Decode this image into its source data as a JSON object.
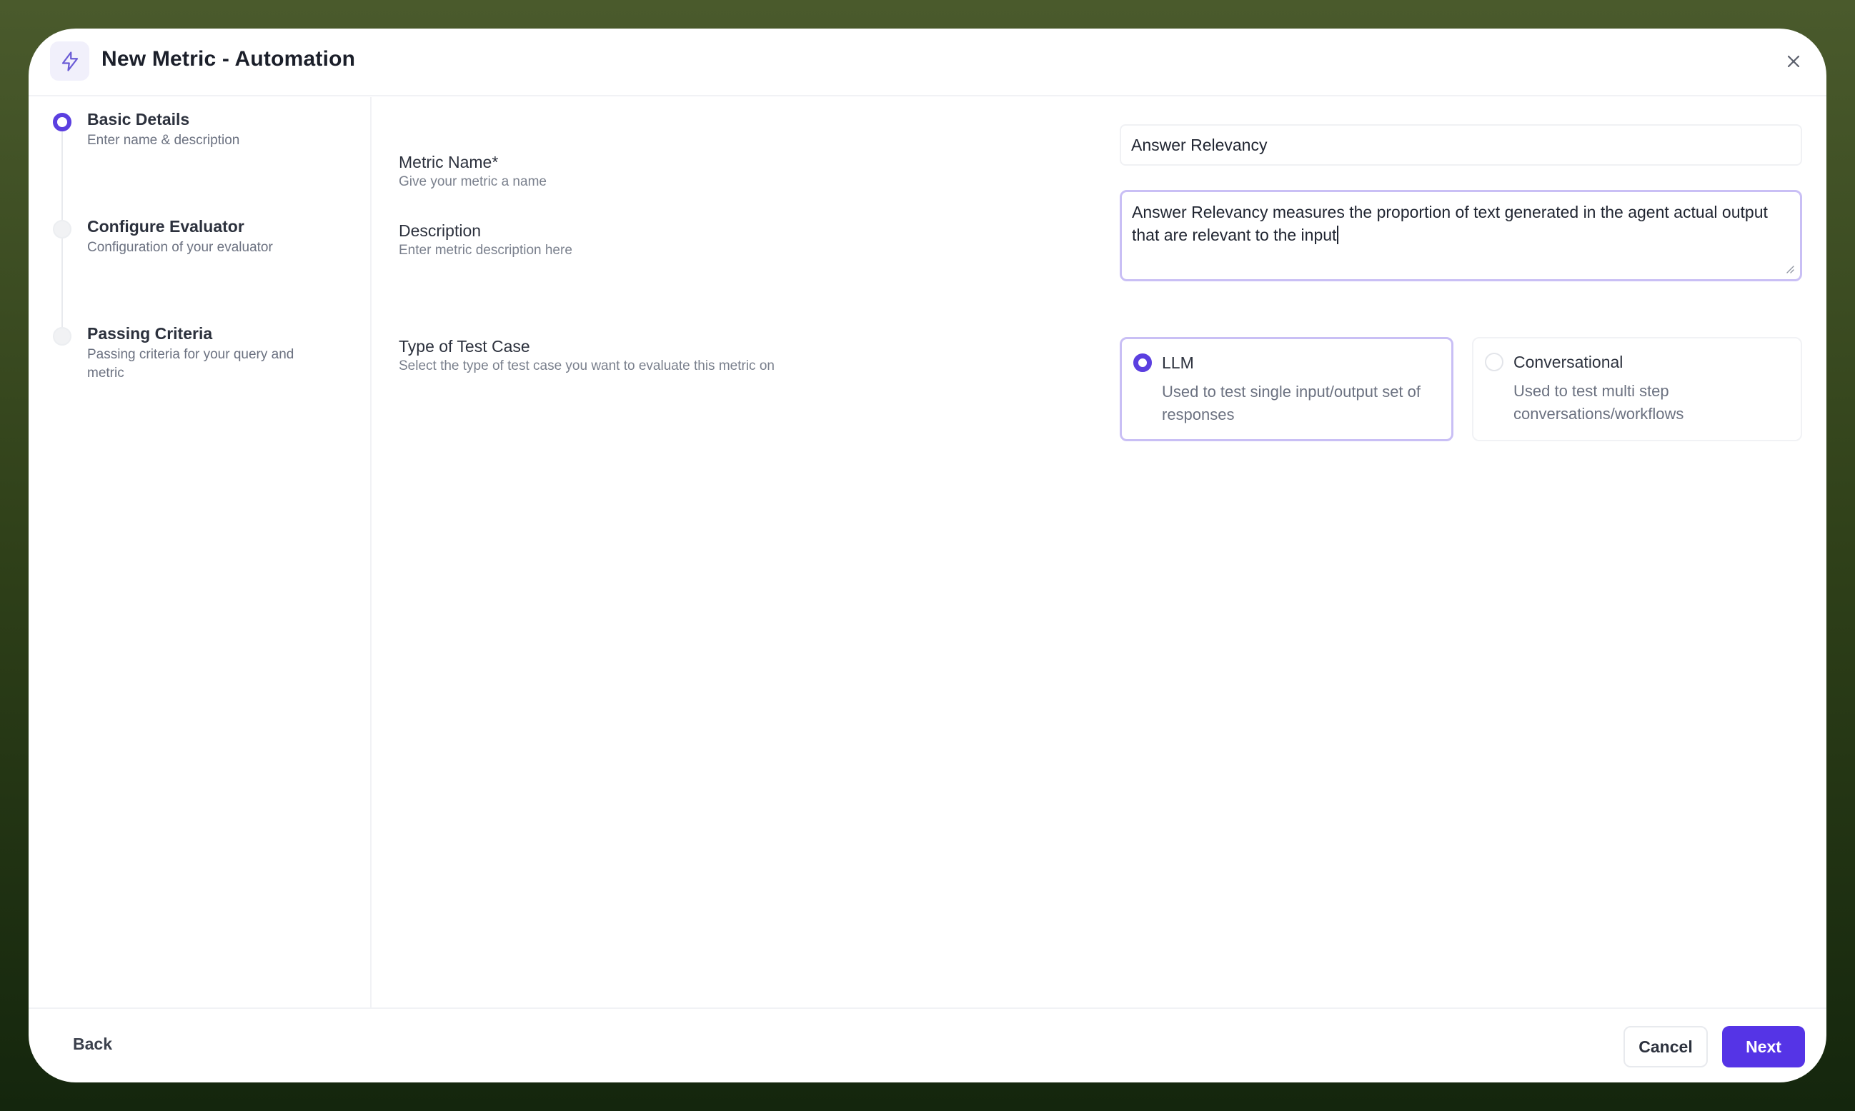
{
  "header": {
    "title": "New Metric - Automation",
    "icon": "lightning-icon",
    "close_icon": "close-icon"
  },
  "stepper": {
    "steps": [
      {
        "title": "Basic Details",
        "subtitle": "Enter name & description",
        "state": "active"
      },
      {
        "title": "Configure Evaluator",
        "subtitle": "Configuration of your evaluator",
        "state": "inactive"
      },
      {
        "title": "Passing Criteria",
        "subtitle": "Passing criteria for your query and metric",
        "state": "inactive"
      }
    ]
  },
  "form": {
    "metric_name": {
      "label": "Metric Name*",
      "help": "Give your metric a name",
      "value": "Answer Relevancy"
    },
    "description": {
      "label": "Description",
      "help": "Enter metric description here",
      "value": "Answer Relevancy measures the proportion of text generated in the agent actual output that are relevant to the input"
    },
    "test_case_type": {
      "label": "Type of Test Case",
      "help": "Select the type of test case you want to evaluate this metric on",
      "options": [
        {
          "title": "LLM",
          "description": "Used to test single input/output set of responses",
          "selected": true
        },
        {
          "title": "Conversational",
          "description": "Used to test multi step conversations/workflows",
          "selected": false
        }
      ]
    }
  },
  "footer": {
    "back_label": "Back",
    "cancel_label": "Cancel",
    "next_label": "Next"
  },
  "colors": {
    "accent": "#5534e6",
    "accent_light": "#c9bff5",
    "background_top": "#4a5a2c",
    "background_bottom": "#14260d"
  }
}
